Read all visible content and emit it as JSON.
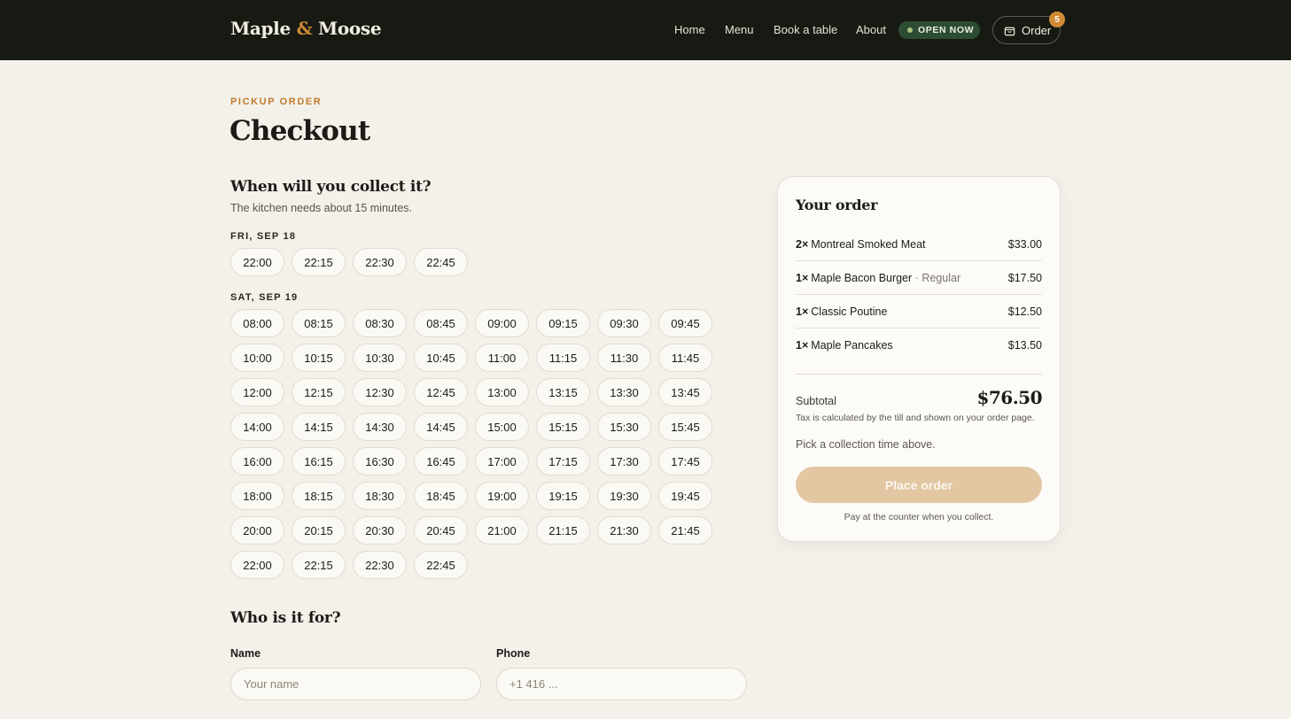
{
  "header": {
    "brand_left": "Maple",
    "brand_amp": "&",
    "brand_right": "Moose",
    "nav": [
      "Home",
      "Menu",
      "Book a table",
      "About"
    ],
    "status_badge": "OPEN NOW",
    "order_label": "Order",
    "cart_count": "5",
    "bag_icon": "shopping-bag-icon"
  },
  "page": {
    "eyebrow": "PICKUP ORDER",
    "title": "Checkout"
  },
  "collection": {
    "title": "When will you collect it?",
    "subtitle": "The kitchen needs about 15 minutes.",
    "days": [
      {
        "label": "FRI, SEP 18",
        "slots": [
          "22:00",
          "22:15",
          "22:30",
          "22:45"
        ]
      },
      {
        "label": "SAT, SEP 19",
        "slots": [
          "08:00",
          "08:15",
          "08:30",
          "08:45",
          "09:00",
          "09:15",
          "09:30",
          "09:45",
          "10:00",
          "10:15",
          "10:30",
          "10:45",
          "11:00",
          "11:15",
          "11:30",
          "11:45",
          "12:00",
          "12:15",
          "12:30",
          "12:45",
          "13:00",
          "13:15",
          "13:30",
          "13:45",
          "14:00",
          "14:15",
          "14:30",
          "14:45",
          "15:00",
          "15:15",
          "15:30",
          "15:45",
          "16:00",
          "16:15",
          "16:30",
          "16:45",
          "17:00",
          "17:15",
          "17:30",
          "17:45",
          "18:00",
          "18:15",
          "18:30",
          "18:45",
          "19:00",
          "19:15",
          "19:30",
          "19:45",
          "20:00",
          "20:15",
          "20:30",
          "20:45",
          "21:00",
          "21:15",
          "21:30",
          "21:45",
          "22:00",
          "22:15",
          "22:30",
          "22:45"
        ]
      }
    ]
  },
  "contact": {
    "title": "Who is it for?",
    "name_label": "Name",
    "name_placeholder": "Your name",
    "name_value": "",
    "phone_label": "Phone",
    "phone_placeholder": "+1 416 ...",
    "phone_value": ""
  },
  "summary": {
    "title": "Your order",
    "items": [
      {
        "qty": "2×",
        "name": "Montreal Smoked Meat",
        "variant": "",
        "price": "$33.00"
      },
      {
        "qty": "1×",
        "name": "Maple Bacon Burger",
        "variant": " · Regular",
        "price": "$17.50"
      },
      {
        "qty": "1×",
        "name": "Classic Poutine",
        "variant": "",
        "price": "$12.50"
      },
      {
        "qty": "1×",
        "name": "Maple Pancakes",
        "variant": "",
        "price": "$13.50"
      }
    ],
    "subtotal_label": "Subtotal",
    "subtotal_value": "$76.50",
    "tax_note": "Tax is calculated by the till and shown on your order page.",
    "pick_note": "Pick a collection time above.",
    "place_order_label": "Place order",
    "pay_note": "Pay at the counter when you collect."
  },
  "colors": {
    "header_bg": "#171a13",
    "accent": "#d08a34",
    "status_green": "#2d4c34",
    "page_bg": "#f4f1eb",
    "place_btn_disabled": "#e2c7a2"
  }
}
